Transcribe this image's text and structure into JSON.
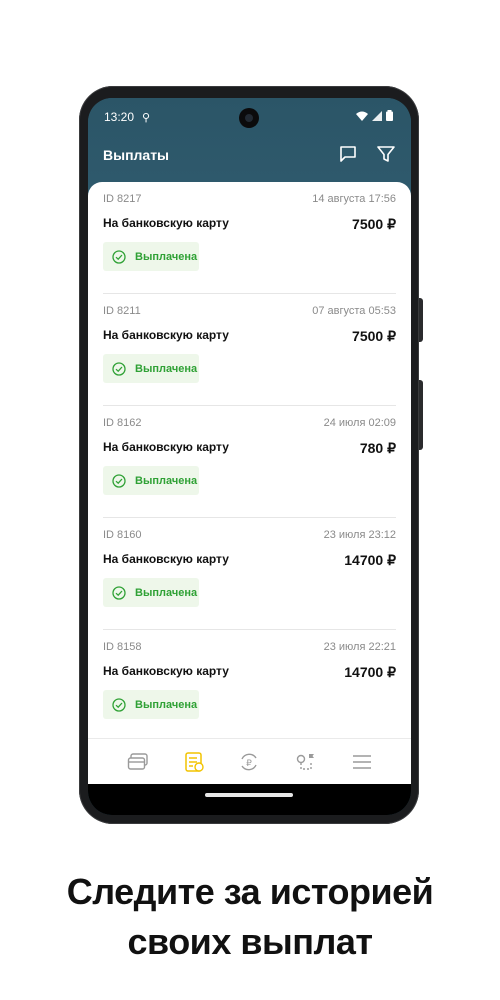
{
  "status_bar": {
    "time": "13:20"
  },
  "app_bar": {
    "title": "Выплаты"
  },
  "payouts": [
    {
      "id": "ID 8217",
      "date": "14 августа 17:56",
      "method": "На банковскую карту",
      "amount": "7500 ₽",
      "status": "Выплачена"
    },
    {
      "id": "ID 8211",
      "date": "07 августа 05:53",
      "method": "На банковскую карту",
      "amount": "7500 ₽",
      "status": "Выплачена"
    },
    {
      "id": "ID 8162",
      "date": "24 июля 02:09",
      "method": "На банковскую карту",
      "amount": "780 ₽",
      "status": "Выплачена"
    },
    {
      "id": "ID 8160",
      "date": "23 июля 23:12",
      "method": "На банковскую карту",
      "amount": "14700 ₽",
      "status": "Выплачена"
    },
    {
      "id": "ID 8158",
      "date": "23 июля 22:21",
      "method": "На банковскую карту",
      "amount": "14700 ₽",
      "status": "Выплачена"
    }
  ],
  "tabs": [
    {
      "icon": "cards-icon",
      "active": false
    },
    {
      "icon": "payouts-list-icon",
      "active": true
    },
    {
      "icon": "ruble-exchange-icon",
      "active": false
    },
    {
      "icon": "route-icon",
      "active": false
    },
    {
      "icon": "menu-icon",
      "active": false
    }
  ],
  "colors": {
    "appbar": "#2b5567",
    "success": "#2fa135",
    "success_bg": "#eef7ea",
    "active_tab": "#f2c300",
    "inactive_tab": "#9a9a9a"
  },
  "caption": {
    "line1": "Следите за историей",
    "line2": "своих выплат"
  }
}
